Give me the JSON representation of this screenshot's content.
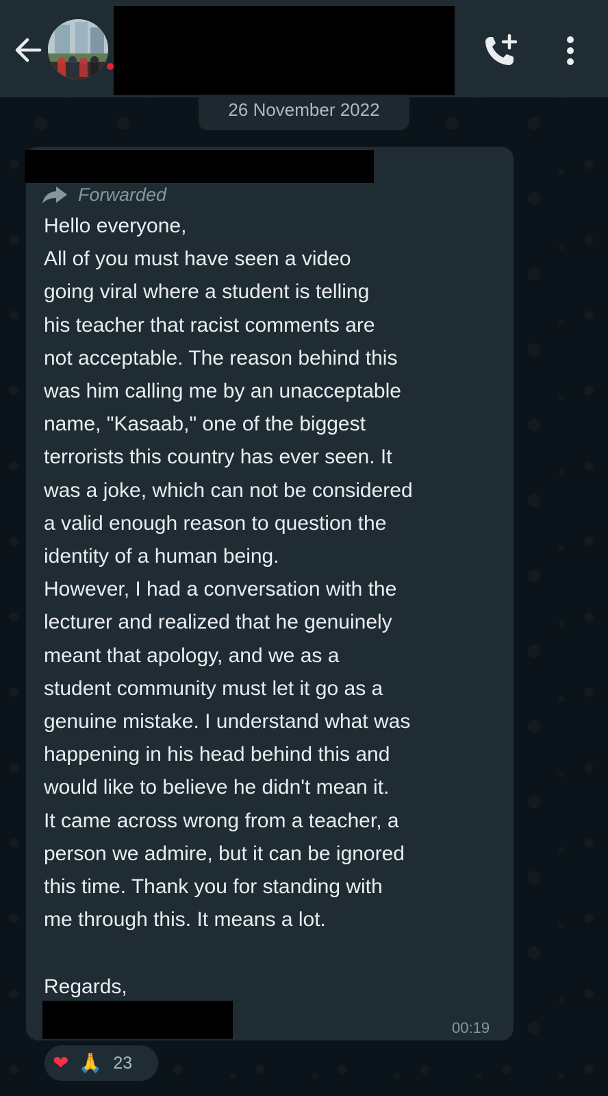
{
  "header": {
    "back_icon": "arrow-left-icon",
    "avatar": "group-avatar",
    "call_icon": "add-call-icon",
    "menu_icon": "more-vertical-icon"
  },
  "date_separator": "26 November 2022",
  "message": {
    "forwarded_label": "Forwarded",
    "body": "Hello everyone,\nAll of you must have seen a video\ngoing viral where a student is telling\nhis teacher that racist comments are\nnot acceptable. The reason behind this\nwas him calling me by an unacceptable\nname, \"Kasaab,\" one of the biggest\nterrorists this country has ever seen. It\nwas a joke, which can not be considered\na valid enough reason to question the\nidentity of a human being.\nHowever, I had a conversation with the\nlecturer and realized that he genuinely\nmeant that apology, and we as a\nstudent community must let it go as a\ngenuine mistake. I understand what was\nhappening in his head behind this and\nwould like to believe he didn't mean it.\nIt came across wrong from a teacher, a\nperson we admire, but it can be ignored\nthis time. Thank you for standing with\nme through this. It means a lot.",
    "closing": "Regards,",
    "time": "00:19"
  },
  "reactions": {
    "emojis": [
      "❤",
      "🙏"
    ],
    "count": "23"
  },
  "colors": {
    "background": "#0b141a",
    "header": "#1f2c34",
    "bubble": "#202c33",
    "text": "#e9edef",
    "muted": "#8696a0"
  }
}
